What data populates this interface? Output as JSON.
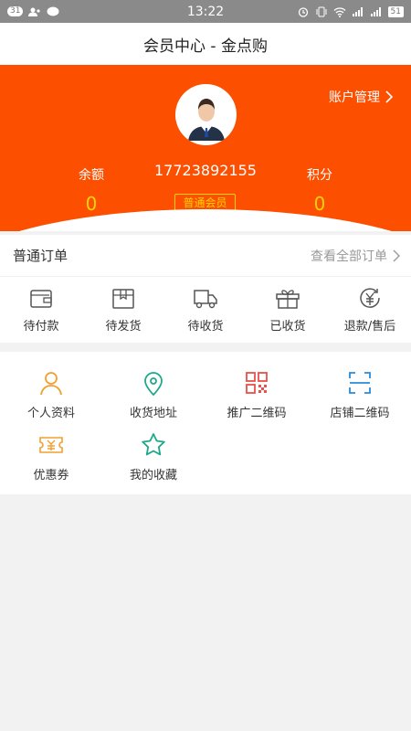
{
  "statusbar": {
    "notif_count": "31",
    "time": "13:22",
    "battery": "51",
    "icons": [
      "notification-badge-icon",
      "contacts-icon",
      "chat-icon",
      "alarm-icon",
      "vibrate-icon",
      "wifi-icon",
      "signal-icon",
      "signal-icon",
      "battery-icon"
    ]
  },
  "header": {
    "title": "会员中心 - 金点购"
  },
  "profile": {
    "account_link": "账户管理",
    "phone": "17723892155",
    "member_level": "普通会员",
    "balance_label": "余额",
    "balance_value": "0",
    "points_label": "积分",
    "points_value": "0",
    "colors": {
      "brand": "#fc4f00",
      "highlight": "#ffd400"
    }
  },
  "orders": {
    "title": "普通订单",
    "view_all": "查看全部订单",
    "items": [
      {
        "label": "待付款",
        "icon": "wallet-icon"
      },
      {
        "label": "待发货",
        "icon": "package-icon"
      },
      {
        "label": "待收货",
        "icon": "truck-icon"
      },
      {
        "label": "已收货",
        "icon": "gift-box-icon"
      },
      {
        "label": "退款/售后",
        "icon": "refund-icon"
      }
    ]
  },
  "features": {
    "items": [
      {
        "label": "个人资料",
        "icon": "user-icon",
        "color": "#f0a030"
      },
      {
        "label": "收货地址",
        "icon": "location-pin-icon",
        "color": "#1ea88a"
      },
      {
        "label": "推广二维码",
        "icon": "qrcode-icon",
        "color": "#e8504a"
      },
      {
        "label": "店铺二维码",
        "icon": "scan-icon",
        "color": "#2a8ad8"
      },
      {
        "label": "优惠券",
        "icon": "coupon-icon",
        "color": "#f0a030"
      },
      {
        "label": "我的收藏",
        "icon": "star-icon",
        "color": "#1ea88a"
      }
    ]
  }
}
